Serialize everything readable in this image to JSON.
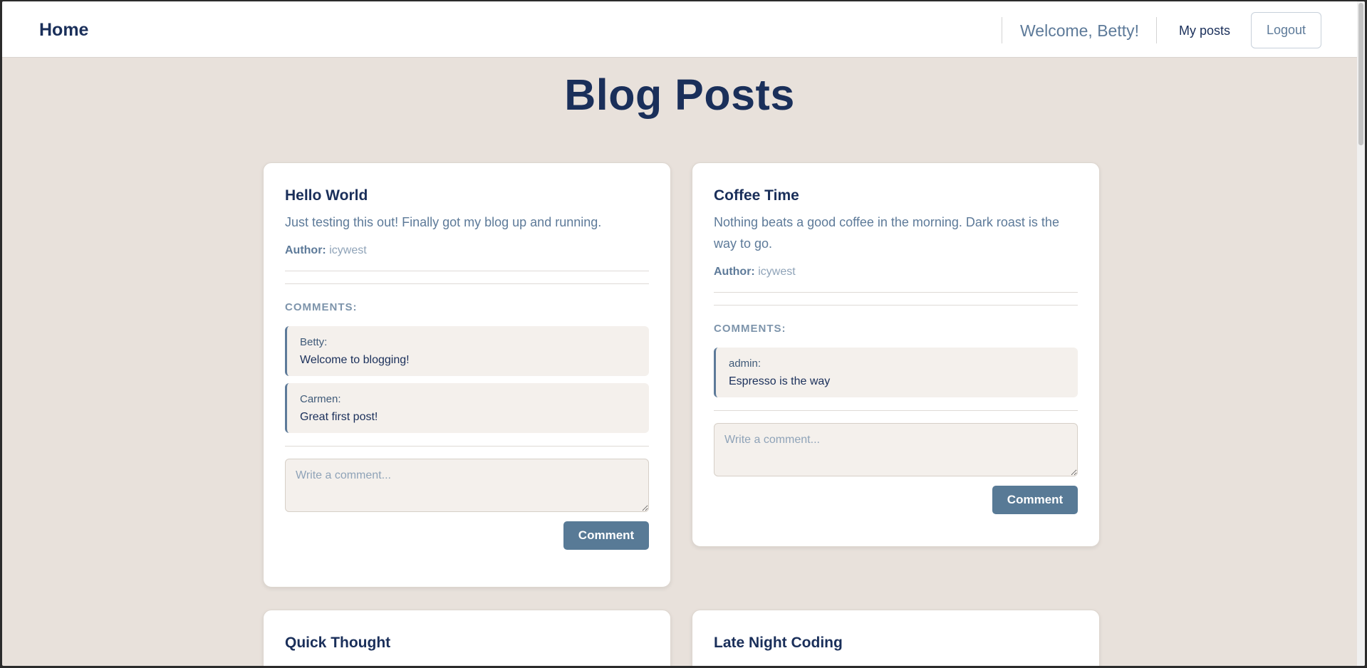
{
  "nav": {
    "brand": "Home",
    "welcome": "Welcome, Betty!",
    "my_posts": "My posts",
    "logout": "Logout"
  },
  "page": {
    "title": "Blog Posts"
  },
  "labels": {
    "author": "Author:",
    "comments": "COMMENTS:",
    "comment_placeholder": "Write a comment...",
    "comment_button": "Comment"
  },
  "posts": [
    {
      "title": "Hello World",
      "body": "Just testing this out! Finally got my blog up and running.",
      "author": "icywest",
      "comments": [
        {
          "author": "Betty:",
          "text": "Welcome to blogging!"
        },
        {
          "author": "Carmen:",
          "text": "Great first post!"
        }
      ]
    },
    {
      "title": "Coffee Time",
      "body": "Nothing beats a good coffee in the morning. Dark roast is the way to go.",
      "author": "icywest",
      "comments": [
        {
          "author": "admin:",
          "text": "Espresso is the way"
        }
      ]
    },
    {
      "title": "Quick Thought"
    },
    {
      "title": "Late Night Coding"
    }
  ]
}
